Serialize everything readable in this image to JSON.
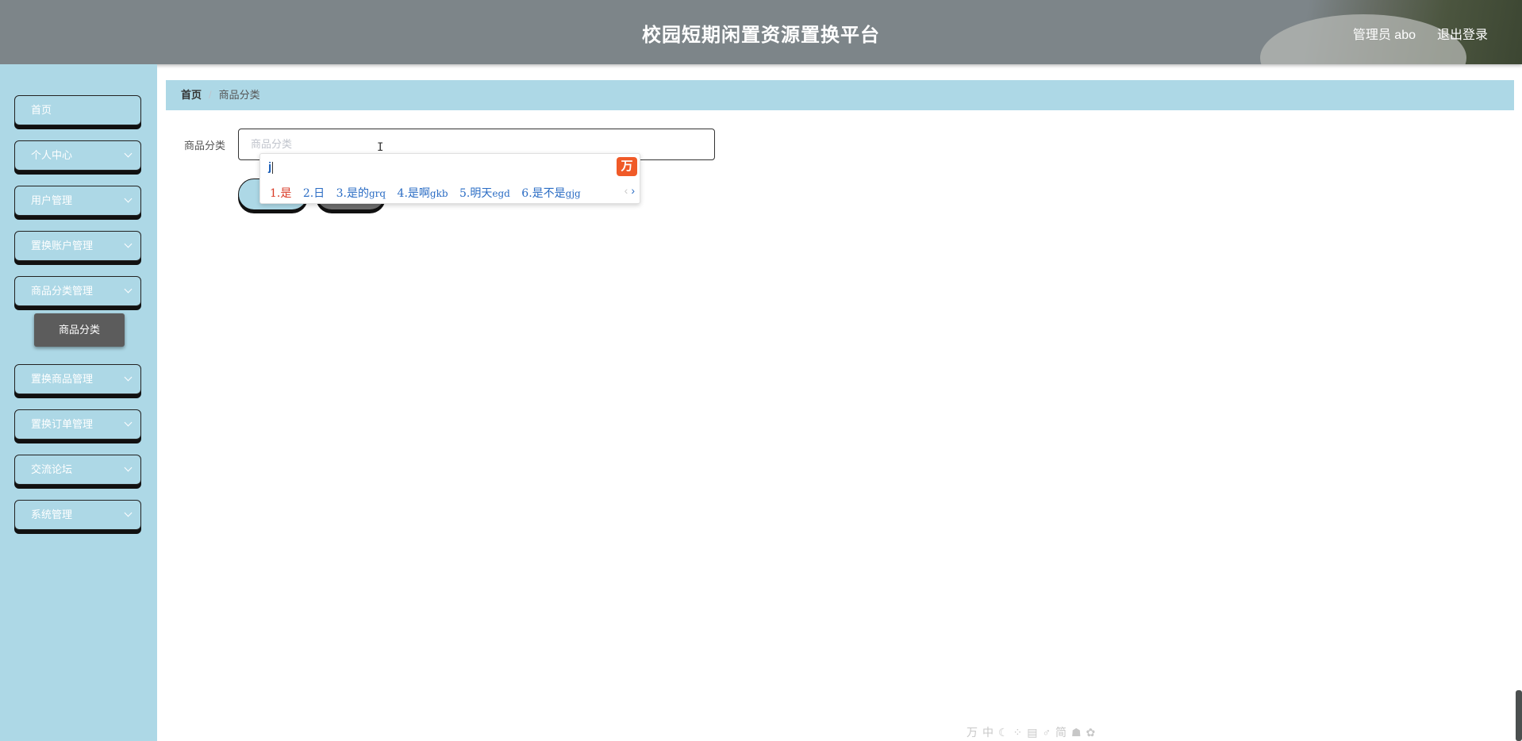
{
  "header": {
    "title": "校园短期闲置资源置换平台",
    "user_label": "管理员 abo",
    "logout_label": "退出登录"
  },
  "sidebar": {
    "items": [
      {
        "label": "首页",
        "has_chevron": false
      },
      {
        "label": "个人中心",
        "has_chevron": true
      },
      {
        "label": "用户管理",
        "has_chevron": true
      },
      {
        "label": "置换账户管理",
        "has_chevron": true
      },
      {
        "label": "商品分类管理",
        "has_chevron": true
      },
      {
        "label": "置换商品管理",
        "has_chevron": true
      },
      {
        "label": "置换订单管理",
        "has_chevron": true
      },
      {
        "label": "交流论坛",
        "has_chevron": true
      },
      {
        "label": "系统管理",
        "has_chevron": true
      }
    ],
    "active_sub_item": "商品分类"
  },
  "breadcrumb": {
    "home": "首页",
    "separator": "/",
    "current": "商品分类"
  },
  "form": {
    "field_label": "商品分类",
    "field_placeholder": "商品分类",
    "field_value": ""
  },
  "ime": {
    "input": "j",
    "logo": "万",
    "candidates": [
      {
        "text": "1.是",
        "code": ""
      },
      {
        "text": "2.日",
        "code": ""
      },
      {
        "text": "3.是的",
        "code": "grq"
      },
      {
        "text": "4.是啊",
        "code": "gkb"
      },
      {
        "text": "5.明天",
        "code": "egd"
      },
      {
        "text": "6.是不是",
        "code": "gjg"
      }
    ],
    "status_bar": "万中☾⁘▤♂简☗✿"
  },
  "colors": {
    "header_bg": "#7d8589",
    "sidebar_bg": "#add8e6",
    "breadcrumb_bg": "#add8e6",
    "active_sub_bg": "#5c5c5c",
    "ime_first": "#d93a26",
    "ime_candidate": "#2a6cc4",
    "ime_logo": "#f05a28"
  }
}
